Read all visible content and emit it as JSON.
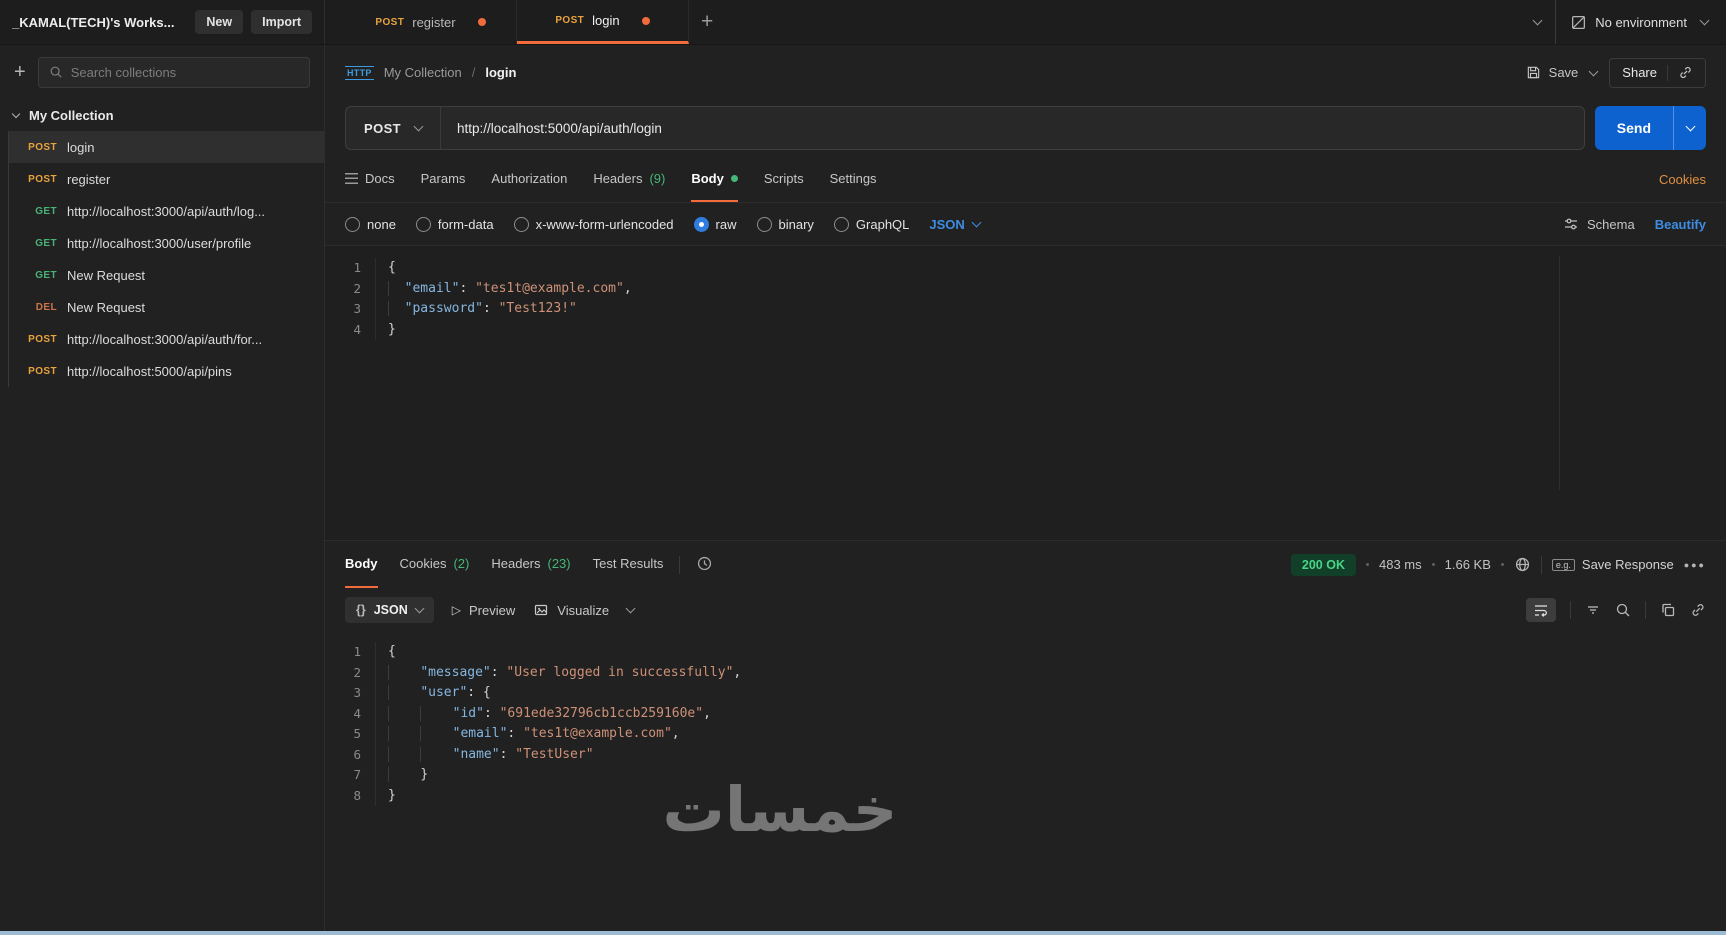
{
  "colors": {
    "accent_orange": "#f26b3a",
    "primary_blue": "#0d62d0",
    "link_blue": "#3e8de3",
    "count_green": "#45b778",
    "status_green": "#4bd488",
    "status_green_bg": "#113f27",
    "code_key": "#85b6e0",
    "code_string": "#ce9178",
    "cookies_orange": "#e0903f"
  },
  "method_colors": {
    "POST": "#e8a33d",
    "GET": "#49b377",
    "DEL": "#cd7448"
  },
  "icons": {
    "plus": "+",
    "braces": "{}",
    "preview_triangle": "▷",
    "more_dots": "●●●",
    "http_badge": "HTTP",
    "example_badge": "e.g.",
    "breadcrumb_separator": "/"
  },
  "topbar": {
    "workspace": "_KAMAL(TECH)'s Works...",
    "new_label": "New",
    "import_label": "Import",
    "tabs": [
      {
        "method": "POST",
        "name": "register",
        "dirty": true,
        "active": false
      },
      {
        "method": "POST",
        "name": "login",
        "dirty": true,
        "active": true
      }
    ],
    "environment": "No environment"
  },
  "sidebar": {
    "search_placeholder": "Search collections",
    "collection": "My Collection",
    "items": [
      {
        "method": "POST",
        "label": "login",
        "selected": true
      },
      {
        "method": "POST",
        "label": "register"
      },
      {
        "method": "GET",
        "label": "http://localhost:3000/api/auth/log..."
      },
      {
        "method": "GET",
        "label": "http://localhost:3000/user/profile"
      },
      {
        "method": "GET",
        "label": "New Request"
      },
      {
        "method": "DEL",
        "label": "New Request"
      },
      {
        "method": "POST",
        "label": "http://localhost:3000/api/auth/for..."
      },
      {
        "method": "POST",
        "label": "http://localhost:5000/api/pins"
      }
    ]
  },
  "request": {
    "breadcrumb": {
      "collection": "My Collection",
      "name": "login"
    },
    "save_label": "Save",
    "share_label": "Share",
    "method": "POST",
    "url": "http://localhost:5000/api/auth/login",
    "send_label": "Send",
    "tabs": [
      {
        "label": "Docs",
        "icon": "docs"
      },
      {
        "label": "Params"
      },
      {
        "label": "Authorization"
      },
      {
        "label": "Headers",
        "count": "(9)"
      },
      {
        "label": "Body",
        "active": true,
        "dot": true
      },
      {
        "label": "Scripts"
      },
      {
        "label": "Settings"
      }
    ],
    "cookies_link": "Cookies",
    "body_types": [
      {
        "label": "none"
      },
      {
        "label": "form-data"
      },
      {
        "label": "x-www-form-urlencoded"
      },
      {
        "label": "raw",
        "selected": true
      },
      {
        "label": "binary"
      },
      {
        "label": "GraphQL"
      }
    ],
    "language": "JSON",
    "schema_label": "Schema",
    "beautify_label": "Beautify",
    "body_lines": [
      {
        "n": 1,
        "t": [
          [
            "p",
            "{"
          ]
        ]
      },
      {
        "n": 2,
        "t": [
          [
            "g",
            "  "
          ],
          [
            "k",
            "\"email\""
          ],
          [
            "p",
            ": "
          ],
          [
            "v",
            "\"tes1t@example.com\""
          ],
          [
            "p",
            ","
          ]
        ]
      },
      {
        "n": 3,
        "t": [
          [
            "g",
            "  "
          ],
          [
            "k",
            "\"password\""
          ],
          [
            "p",
            ": "
          ],
          [
            "v",
            "\"Test123!\""
          ]
        ]
      },
      {
        "n": 4,
        "t": [
          [
            "p",
            "}"
          ]
        ]
      }
    ]
  },
  "response": {
    "tabs": [
      {
        "label": "Body",
        "active": true
      },
      {
        "label": "Cookies",
        "count": "(2)"
      },
      {
        "label": "Headers",
        "count": "(23)"
      },
      {
        "label": "Test Results"
      }
    ],
    "status": "200 OK",
    "time": "483 ms",
    "size": "1.66 KB",
    "save_label": "Save Response",
    "format": "JSON",
    "preview_label": "Preview",
    "visualize_label": "Visualize",
    "body_lines": [
      {
        "n": 1,
        "t": [
          [
            "p",
            "{"
          ]
        ]
      },
      {
        "n": 2,
        "t": [
          [
            "g",
            "    "
          ],
          [
            "k",
            "\"message\""
          ],
          [
            "p",
            ": "
          ],
          [
            "v",
            "\"User logged in successfully\""
          ],
          [
            "p",
            ","
          ]
        ]
      },
      {
        "n": 3,
        "t": [
          [
            "g",
            "    "
          ],
          [
            "k",
            "\"user\""
          ],
          [
            "p",
            ": {"
          ]
        ]
      },
      {
        "n": 4,
        "t": [
          [
            "g",
            "    "
          ],
          [
            "g",
            "    "
          ],
          [
            "k",
            "\"id\""
          ],
          [
            "p",
            ": "
          ],
          [
            "v",
            "\"691ede32796cb1ccb259160e\""
          ],
          [
            "p",
            ","
          ]
        ]
      },
      {
        "n": 5,
        "t": [
          [
            "g",
            "    "
          ],
          [
            "g",
            "    "
          ],
          [
            "k",
            "\"email\""
          ],
          [
            "p",
            ": "
          ],
          [
            "v",
            "\"tes1t@example.com\""
          ],
          [
            "p",
            ","
          ]
        ]
      },
      {
        "n": 6,
        "t": [
          [
            "g",
            "    "
          ],
          [
            "g",
            "    "
          ],
          [
            "k",
            "\"name\""
          ],
          [
            "p",
            ": "
          ],
          [
            "v",
            "\"TestUser\""
          ]
        ]
      },
      {
        "n": 7,
        "t": [
          [
            "g",
            "    "
          ],
          [
            "p",
            "}"
          ]
        ]
      },
      {
        "n": 8,
        "t": [
          [
            "p",
            "}"
          ]
        ]
      }
    ]
  },
  "watermark": "خمسات"
}
